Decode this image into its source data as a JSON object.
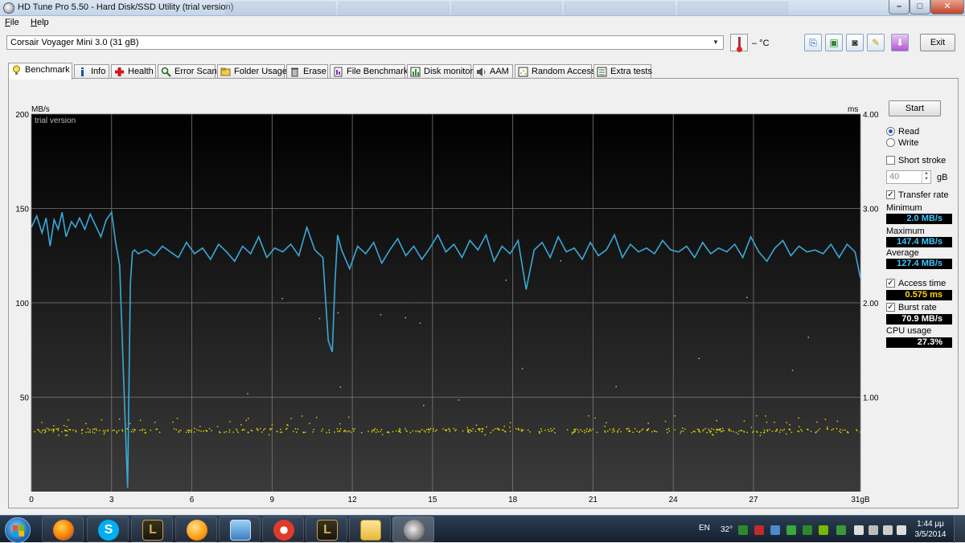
{
  "window": {
    "title": "HD Tune Pro 5.50 - Hard Disk/SSD Utility (trial version)",
    "close_label": "✕",
    "minimize_label": "–",
    "maximize_label": "□"
  },
  "menu": [
    {
      "key": "F",
      "rest": "ile"
    },
    {
      "key": "H",
      "rest": "elp"
    }
  ],
  "toolbar": {
    "drive": "Corsair Voyager Mini 3.0 (31 gB)",
    "temperature": "– °C",
    "exit_label": "Exit",
    "buttons": [
      "copy-text-icon",
      "copy-screenshot-icon",
      "camera-icon",
      "options-icon",
      "save-icon"
    ]
  },
  "tabs": [
    {
      "label": "Benchmark",
      "icon": "bulb-icon",
      "active": true
    },
    {
      "label": "Info",
      "icon": "info-icon"
    },
    {
      "label": "Health",
      "icon": "health-cross-icon"
    },
    {
      "label": "Error Scan",
      "icon": "magnifier-icon"
    },
    {
      "label": "Folder Usage",
      "icon": "folder-icon"
    },
    {
      "label": "Erase",
      "icon": "trash-icon"
    },
    {
      "label": "File Benchmark",
      "icon": "file-benchmark-icon"
    },
    {
      "label": "Disk monitor",
      "icon": "disk-monitor-icon"
    },
    {
      "label": "AAM",
      "icon": "speaker-icon"
    },
    {
      "label": "Random Access",
      "icon": "random-access-icon"
    },
    {
      "label": "Extra tests",
      "icon": "extra-tests-icon"
    }
  ],
  "side_panel": {
    "start_label": "Start",
    "read_label": "Read",
    "write_label": "Write",
    "mode": "Read",
    "short_stroke_label": "Short stroke",
    "short_stroke_checked": false,
    "short_stroke_value": "40",
    "short_stroke_unit": "gB",
    "transfer_rate_label": "Transfer rate",
    "transfer_rate_checked": true,
    "minimum_label": "Minimum",
    "minimum_value": "2.0 MB/s",
    "maximum_label": "Maximum",
    "maximum_value": "147.4 MB/s",
    "average_label": "Average",
    "average_value": "127.4 MB/s",
    "access_time_label": "Access time",
    "access_time_checked": true,
    "access_time_value": "0.575 ms",
    "burst_rate_label": "Burst rate",
    "burst_rate_checked": true,
    "burst_rate_value": "70.9 MB/s",
    "cpu_usage_label": "CPU usage",
    "cpu_usage_value": "27.3%"
  },
  "chart_data": {
    "type": "line",
    "watermark": "trial version",
    "y_left_label": "MB/s",
    "y_right_label": "ms",
    "x_unit": "gB",
    "xlim": [
      0,
      31
    ],
    "ylim_left": [
      0,
      200
    ],
    "ylim_right": [
      0,
      4.0
    ],
    "x_ticks": [
      "0",
      "3",
      "6",
      "9",
      "12",
      "15",
      "18",
      "21",
      "24",
      "27",
      "31"
    ],
    "y_left_ticks": [
      "50",
      "100",
      "150",
      "200"
    ],
    "y_right_ticks": [
      "1.00",
      "2.00",
      "3.00",
      "4.00"
    ],
    "grid": true,
    "colors": {
      "transfer": "#3aa9d8",
      "access": "#e8e000",
      "background_top": "#000000",
      "background_bottom": "#3a3a3a"
    },
    "series": [
      {
        "name": "Transfer rate",
        "kind": "line",
        "x": [
          0.0,
          0.2,
          0.4,
          0.55,
          0.7,
          0.85,
          1.0,
          1.15,
          1.3,
          1.5,
          1.65,
          1.8,
          2.0,
          2.2,
          2.4,
          2.6,
          2.8,
          3.0,
          3.15,
          3.3,
          3.45,
          3.6,
          3.7,
          3.78,
          3.86,
          4.0,
          4.3,
          4.6,
          4.9,
          5.2,
          5.5,
          5.8,
          6.1,
          6.4,
          6.7,
          7.0,
          7.3,
          7.6,
          7.9,
          8.2,
          8.5,
          8.8,
          9.1,
          9.4,
          9.7,
          10.0,
          10.3,
          10.6,
          10.9,
          11.1,
          11.25,
          11.35,
          11.45,
          11.6,
          11.9,
          12.2,
          12.5,
          12.8,
          13.1,
          13.4,
          13.7,
          14.0,
          14.3,
          14.6,
          14.9,
          15.2,
          15.5,
          15.8,
          16.1,
          16.4,
          16.7,
          17.0,
          17.3,
          17.6,
          17.9,
          18.2,
          18.5,
          18.8,
          19.1,
          19.4,
          19.7,
          20.0,
          20.3,
          20.6,
          20.9,
          21.2,
          21.5,
          21.8,
          22.1,
          22.4,
          22.7,
          23.0,
          23.3,
          23.6,
          23.9,
          24.2,
          24.5,
          24.8,
          25.1,
          25.4,
          25.7,
          26.0,
          26.3,
          26.6,
          26.9,
          27.2,
          27.5,
          27.8,
          28.1,
          28.4,
          28.7,
          29.0,
          29.3,
          29.6,
          29.9,
          30.2,
          30.5,
          30.8,
          31.0
        ],
        "y": [
          140,
          146,
          137,
          145,
          130,
          144,
          139,
          148,
          135,
          143,
          140,
          145,
          139,
          147,
          141,
          135,
          144,
          148,
          132,
          120,
          60,
          2,
          110,
          127,
          128,
          126,
          128,
          125,
          130,
          127,
          124,
          132,
          126,
          129,
          123,
          131,
          127,
          122,
          130,
          126,
          135,
          124,
          129,
          127,
          131,
          125,
          140,
          128,
          124,
          80,
          74,
          110,
          136,
          128,
          118,
          130,
          126,
          132,
          121,
          128,
          134,
          125,
          130,
          123,
          129,
          136,
          127,
          131,
          124,
          133,
          128,
          136,
          122,
          130,
          126,
          133,
          107,
          128,
          132,
          124,
          135,
          127,
          129,
          123,
          132,
          125,
          128,
          136,
          124,
          131,
          127,
          129,
          126,
          133,
          128,
          127,
          130,
          124,
          132,
          126,
          129,
          127,
          131,
          124,
          135,
          127,
          122,
          129,
          133,
          125,
          130,
          127,
          128,
          126,
          131,
          124,
          131,
          127,
          113
        ]
      }
    ],
    "access_time_band_ms": [
      0.6,
      0.75
    ],
    "access_time_average_ms": 0.575
  },
  "taskbar": {
    "apps": [
      "firefox-icon",
      "skype-icon",
      "league-of-legends-icon",
      "vlc-icon",
      "control-panel-icon",
      "ccleaner-icon",
      "league-of-legends-icon",
      "explorer-icon",
      "hd-tune-icon"
    ],
    "tray_lang": "EN",
    "tray_temp": "32°",
    "clock_time": "1:44 μμ",
    "clock_date": "3/5/2014"
  }
}
